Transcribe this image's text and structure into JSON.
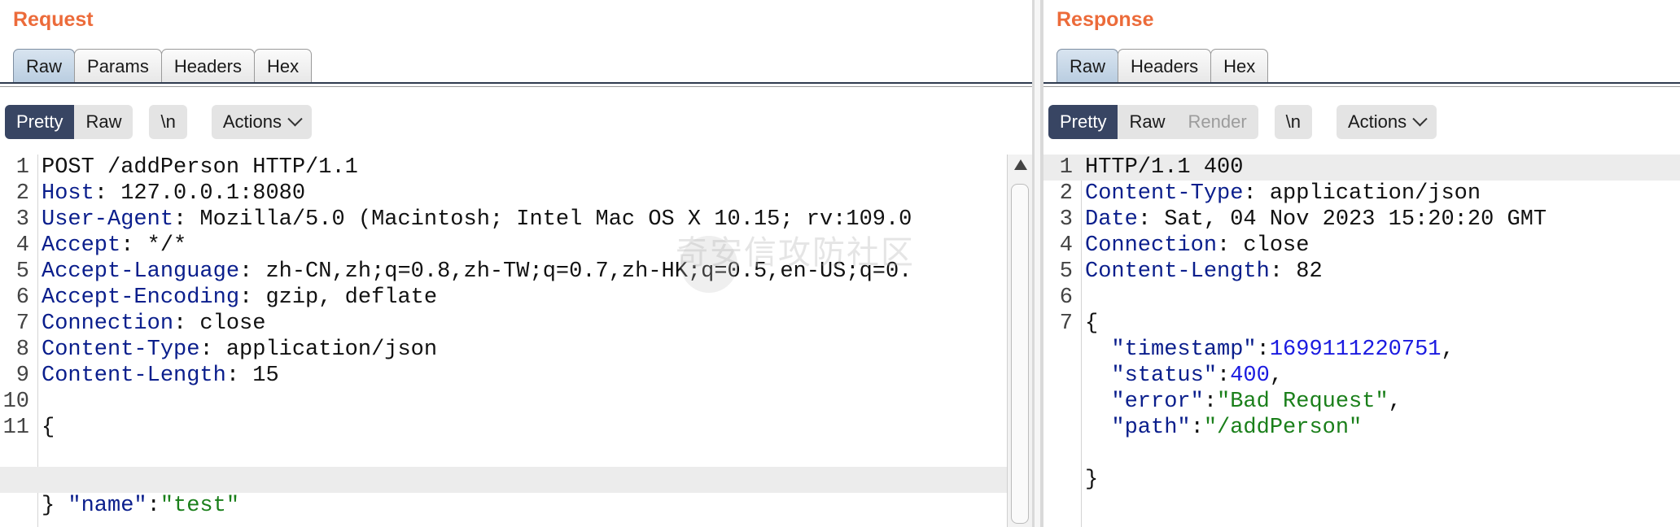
{
  "request": {
    "title": "Request",
    "tabs": [
      {
        "label": "Raw",
        "active": true
      },
      {
        "label": "Params",
        "active": false
      },
      {
        "label": "Headers",
        "active": false
      },
      {
        "label": "Hex",
        "active": false
      }
    ],
    "toolbar": {
      "pretty": "Pretty",
      "raw": "Raw",
      "newline": "\\n",
      "actions": "Actions"
    },
    "lines": [
      {
        "n": "1",
        "k": "",
        "v": "POST /addPerson HTTP/1.1"
      },
      {
        "n": "2",
        "k": "Host",
        "v": ": 127.0.0.1:8080"
      },
      {
        "n": "3",
        "k": "User-Agent",
        "v": ": Mozilla/5.0 (Macintosh; Intel Mac OS X 10.15; rv:109.0"
      },
      {
        "n": "4",
        "k": "Accept",
        "v": ": */*"
      },
      {
        "n": "5",
        "k": "Accept-Language",
        "v": ": zh-CN,zh;q=0.8,zh-TW;q=0.7,zh-HK;q=0.5,en-US;q=0."
      },
      {
        "n": "6",
        "k": "Accept-Encoding",
        "v": ": gzip, deflate"
      },
      {
        "n": "7",
        "k": "Connection",
        "v": ": close"
      },
      {
        "n": "8",
        "k": "Content-Type",
        "v": ": application/json"
      },
      {
        "n": "9",
        "k": "Content-Length",
        "v": ": 15"
      },
      {
        "n": "10",
        "k": "",
        "v": ""
      },
      {
        "n": "11",
        "k": "",
        "v": "{"
      }
    ],
    "body_line": {
      "indent": "  ",
      "key": "\"name\"",
      "sep": ":",
      "value": "\"test\""
    },
    "close_brace": "}"
  },
  "response": {
    "title": "Response",
    "tabs": [
      {
        "label": "Raw",
        "active": true
      },
      {
        "label": "Headers",
        "active": false
      },
      {
        "label": "Hex",
        "active": false
      }
    ],
    "toolbar": {
      "pretty": "Pretty",
      "raw": "Raw",
      "render": "Render",
      "newline": "\\n",
      "actions": "Actions"
    },
    "lines": [
      {
        "n": "1",
        "k": "",
        "v": "HTTP/1.1 400"
      },
      {
        "n": "2",
        "k": "Content-Type",
        "v": ": application/json"
      },
      {
        "n": "3",
        "k": "Date",
        "v": ": Sat, 04 Nov 2023 15:20:20 GMT"
      },
      {
        "n": "4",
        "k": "Connection",
        "v": ": close"
      },
      {
        "n": "5",
        "k": "Content-Length",
        "v": ": 82"
      },
      {
        "n": "6",
        "k": "",
        "v": ""
      },
      {
        "n": "7",
        "k": "",
        "v": "{"
      }
    ],
    "json": [
      {
        "key": "\"timestamp\"",
        "value": "1699111220751",
        "type": "num",
        "comma": ","
      },
      {
        "key": "\"status\"",
        "value": "400",
        "type": "num",
        "comma": ","
      },
      {
        "key": "\"error\"",
        "value": "\"Bad Request\"",
        "type": "str",
        "comma": ","
      },
      {
        "key": "\"path\"",
        "value": "\"/addPerson\"",
        "type": "str",
        "comma": ""
      }
    ],
    "close_brace": "}"
  },
  "watermark": "奇安信攻防社区"
}
